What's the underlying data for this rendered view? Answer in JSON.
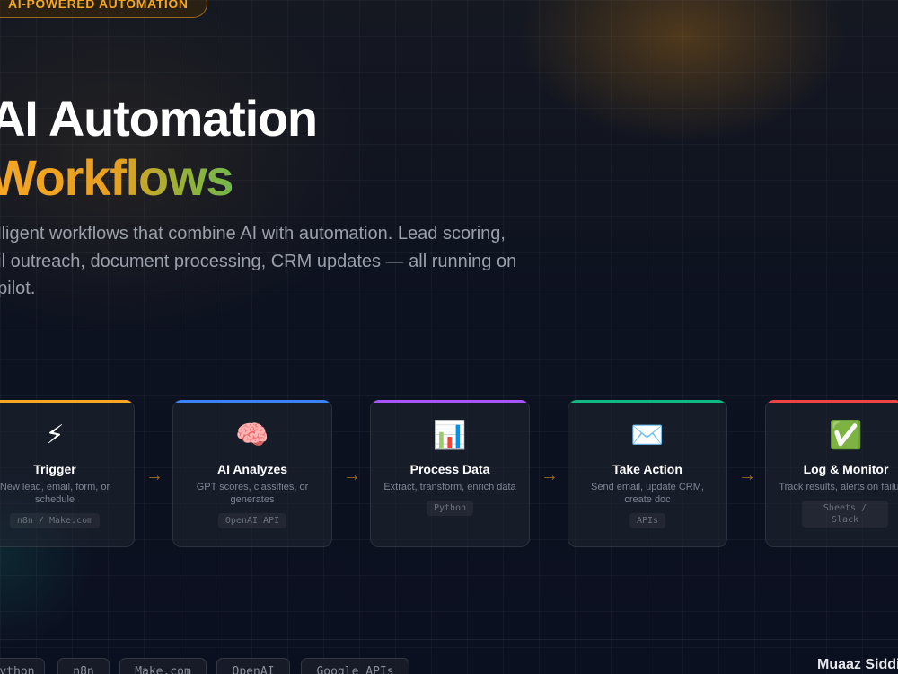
{
  "badge": {
    "label": "AI-POWERED AUTOMATION"
  },
  "hero": {
    "title_line1": "AI Automation",
    "title_line2": "Workflows",
    "description_lines": [
      "elligent workflows that combine AI with automation. Lead scoring,",
      "ail outreach, document processing, CRM updates — all running on",
      "opilot."
    ]
  },
  "colors": {
    "accent": "#f5a623",
    "gradient_end": "#3fbf6c",
    "trigger": "#f5a623",
    "ai_analyzes": "#3b82f6",
    "process_data": "#a855f7",
    "take_action": "#10b981",
    "log_monitor": "#ef4444"
  },
  "steps": [
    {
      "icon": "lightning-bolt-icon",
      "emoji": "⚡",
      "title": "Trigger",
      "desc": "New lead, email, form, or schedule",
      "tag": "n8n / Make.com"
    },
    {
      "icon": "brain-icon",
      "emoji": "🧠",
      "title": "AI Analyzes",
      "desc": "GPT scores, classifies, or generates",
      "tag": "OpenAI API"
    },
    {
      "icon": "bar-chart-icon",
      "emoji": "📊",
      "title": "Process Data",
      "desc": "Extract, transform, enrich data",
      "tag": "Python"
    },
    {
      "icon": "envelope-icon",
      "emoji": "✉️",
      "title": "Take Action",
      "desc": "Send email, update CRM, create doc",
      "tag": "APIs"
    },
    {
      "icon": "check-mark-icon",
      "emoji": "✅",
      "title": "Log & Monitor",
      "desc": "Track results, alerts on failures",
      "tag": "Sheets / Slack"
    }
  ],
  "arrow_glyph": "→",
  "tech_chips": [
    "Python",
    "n8n",
    "Make.com",
    "OpenAI",
    "Google APIs"
  ],
  "author": {
    "name": "Muaaz Siddi"
  }
}
